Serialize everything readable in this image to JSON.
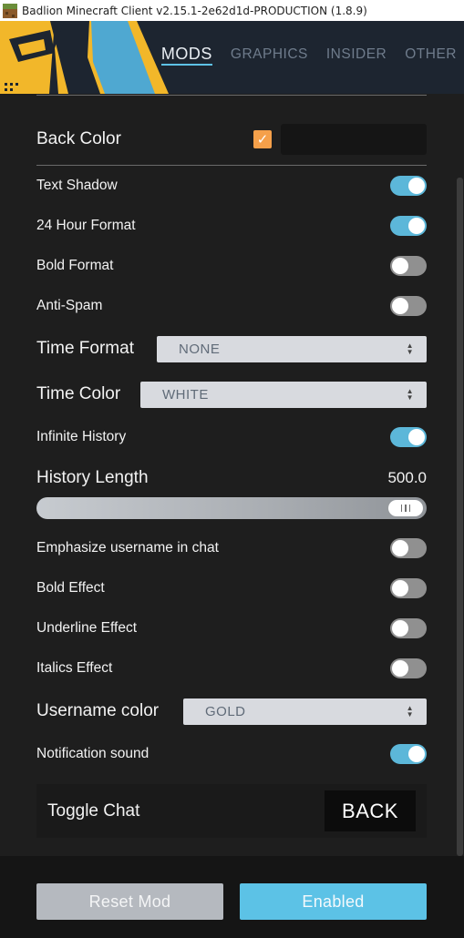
{
  "window": {
    "title": "Badlion Minecraft Client v2.15.1-2e62d1d-PRODUCTION (1.8.9)",
    "icon": "minecraft-grass-block-icon"
  },
  "nav": {
    "tabs": [
      {
        "label": "MODS",
        "active": true
      },
      {
        "label": "GRAPHICS",
        "active": false
      },
      {
        "label": "INSIDER",
        "active": false
      },
      {
        "label": "OTHER",
        "active": false
      }
    ]
  },
  "settings": {
    "back_color": {
      "label": "Back Color",
      "checked": true,
      "check_glyph": "✓",
      "swatch": "#151515"
    },
    "text_shadow": {
      "label": "Text Shadow",
      "on": true
    },
    "hour24": {
      "label": "24 Hour Format",
      "on": true
    },
    "bold_format": {
      "label": "Bold Format",
      "on": false
    },
    "anti_spam": {
      "label": "Anti-Spam",
      "on": false
    },
    "time_format": {
      "label": "Time Format",
      "value": "NONE"
    },
    "time_color": {
      "label": "Time Color",
      "value": "WHITE"
    },
    "infinite_history": {
      "label": "Infinite History",
      "on": true
    },
    "history_length": {
      "label": "History Length",
      "value": "500.0",
      "fraction": 1.0
    },
    "emphasize_username": {
      "label": "Emphasize username in chat",
      "on": false
    },
    "bold_effect": {
      "label": "Bold Effect",
      "on": false
    },
    "underline_effect": {
      "label": "Underline Effect",
      "on": false
    },
    "italics_effect": {
      "label": "Italics Effect",
      "on": false
    },
    "username_color": {
      "label": "Username color",
      "value": "GOLD"
    },
    "notification_sound": {
      "label": "Notification sound",
      "on": true
    },
    "toggle_chat": {
      "label": "Toggle Chat",
      "key": "BACK"
    }
  },
  "footer": {
    "reset_label": "Reset Mod",
    "enabled_label": "Enabled"
  },
  "colors": {
    "accent": "#5cc2e6",
    "toggle_on": "#5cb7d9",
    "checkbox": "#f5a04a",
    "logo_yellow": "#f2b72a",
    "logo_blue": "#4fa8d1"
  }
}
